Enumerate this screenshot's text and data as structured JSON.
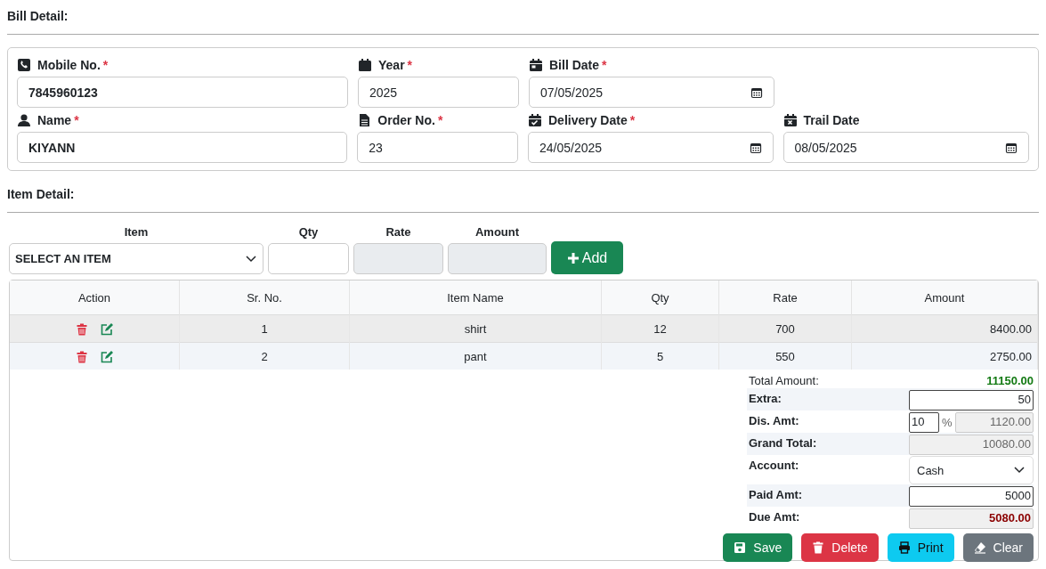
{
  "bill_detail": {
    "title": "Bill Detail:",
    "rows": [
      [
        {
          "label": "Mobile No.",
          "mark": "*",
          "kind": "text",
          "value": "7845960123",
          "bold": true
        },
        {
          "label": "Year",
          "mark": "*",
          "kind": "text",
          "value": "2025",
          "bold": false
        },
        {
          "label": "Bill Date",
          "mark": "*",
          "kind": "date",
          "value": "07/05/2025",
          "bold": false
        }
      ],
      [
        {
          "label": "Name",
          "mark": "*",
          "kind": "text",
          "value": "KIYANN",
          "bold": true
        },
        {
          "label": "Order No.",
          "mark": "*",
          "kind": "text",
          "value": "23",
          "bold": false
        },
        {
          "label": "Delivery Date",
          "mark": "*",
          "kind": "date",
          "value": "24/05/2025",
          "bold": false
        },
        {
          "label": "Trail Date",
          "kind": "date",
          "value": "08/05/2025",
          "bold": false
        }
      ]
    ]
  },
  "item_detail": {
    "title": "Item Detail:",
    "entry": {
      "labels": [
        "Item",
        "Qty",
        "Rate",
        "Amount"
      ],
      "item_select": "SELECT AN ITEM",
      "add_button": "Add"
    },
    "table": {
      "columns": [
        "Action",
        "Sr. No.",
        "Item Name",
        "Qty",
        "Rate",
        "Amount"
      ],
      "rows": [
        {
          "cells": [
            "",
            "1",
            "shirt",
            "12",
            "700",
            "8400.00"
          ]
        },
        {
          "cells": [
            "",
            "2",
            "pant",
            "5",
            "550",
            "2750.00"
          ]
        }
      ]
    },
    "summary": [
      {
        "label": "Total Amount:",
        "kind": "total",
        "value": "11150.00",
        "color": "#137a13"
      },
      {
        "label": "Extra:",
        "kind": "input",
        "value": "50"
      },
      {
        "label": "Dis. Amt:",
        "kind": "percent",
        "value": "10",
        "unit": "%",
        "amount": "1120.00"
      },
      {
        "label": "Grand Total:",
        "kind": "readonly",
        "value": "10080.00"
      },
      {
        "label": "Account:",
        "kind": "select",
        "value": "Cash"
      },
      {
        "label": "Paid Amt:",
        "kind": "input",
        "value": "5000"
      },
      {
        "label": "Due Amt:",
        "kind": "readonly",
        "value": "5080.00",
        "color": "#8b0000"
      }
    ],
    "buttons": [
      {
        "label": "Save",
        "kind": "save"
      },
      {
        "label": "Delete",
        "kind": "delete"
      },
      {
        "label": "Print",
        "kind": "print"
      },
      {
        "label": "Clear",
        "kind": "clear"
      }
    ]
  }
}
